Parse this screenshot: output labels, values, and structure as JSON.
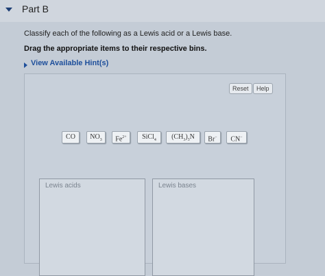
{
  "section": {
    "title": "Part B"
  },
  "question": {
    "text": "Classify each of the following as a Lewis acid or a Lewis base.",
    "instruction": "Drag the appropriate items to their respective bins."
  },
  "hint": {
    "label": "View Available Hint(s)"
  },
  "toolbar": {
    "reset_label": "Reset",
    "help_label": "Help"
  },
  "items": [
    {
      "main": "CO"
    },
    {
      "main": "NO",
      "sub": "3"
    },
    {
      "main": "Fe",
      "sup": "2+"
    },
    {
      "main": "SiCl",
      "sub": "4"
    },
    {
      "main": "(CH",
      "sub": "3",
      "main2": ")",
      "sub2": "3",
      "main3": "N"
    },
    {
      "main": "Br",
      "sup": "−"
    },
    {
      "main": "CN",
      "sup": "−"
    }
  ],
  "bins": {
    "acids": {
      "label": "Lewis acids"
    },
    "bases": {
      "label": "Lewis bases"
    }
  },
  "colors": {
    "link": "#1e4f9b",
    "header_triangle": "#1e3f75"
  }
}
